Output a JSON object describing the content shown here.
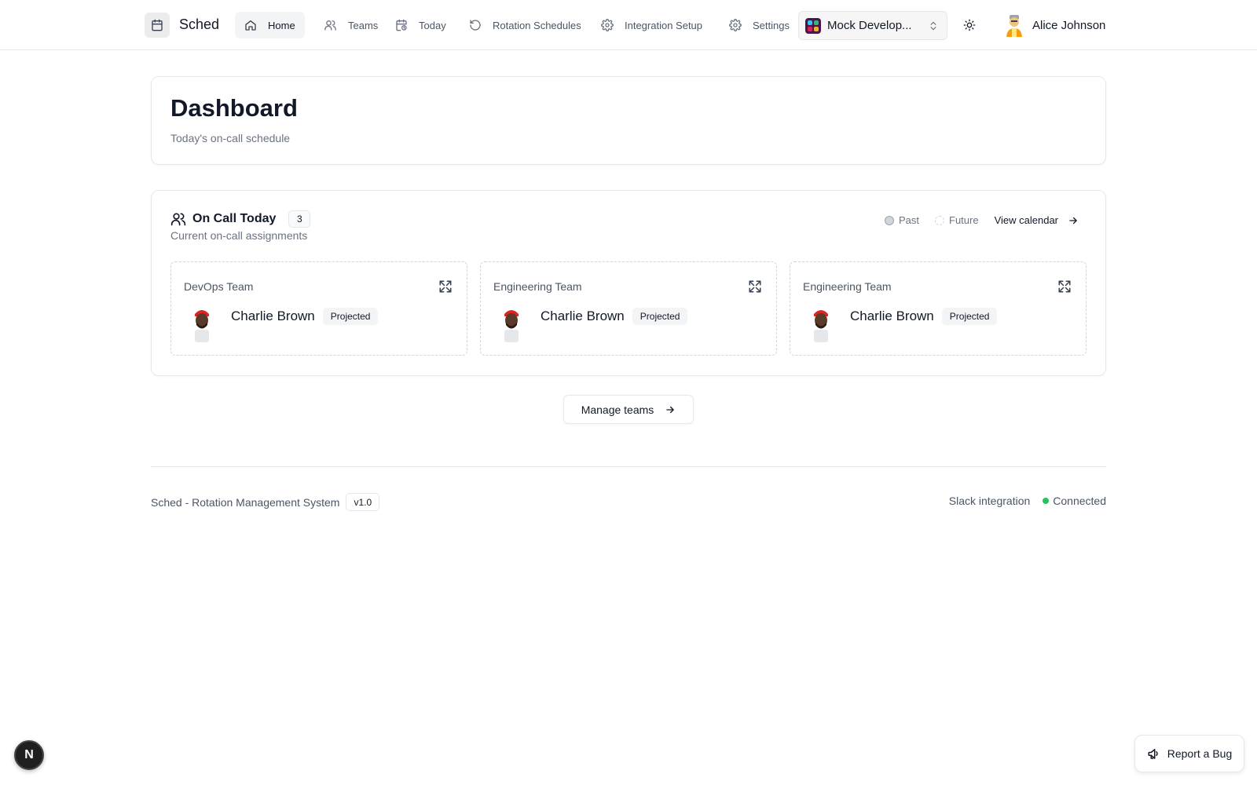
{
  "app": {
    "name": "Sched"
  },
  "nav": {
    "items": [
      {
        "label": "Home",
        "icon": "home-icon",
        "active": true
      },
      {
        "label": "Teams",
        "icon": "users-icon"
      },
      {
        "label": "Today",
        "icon": "calendar-clock-icon"
      },
      {
        "label": "Rotation Schedules",
        "icon": "rotate-icon"
      },
      {
        "label": "Integration Setup",
        "icon": "gear-icon"
      },
      {
        "label": "Settings",
        "icon": "gear-icon"
      }
    ]
  },
  "workspace": {
    "name": "Mock Develop..."
  },
  "user": {
    "name": "Alice Johnson"
  },
  "header": {
    "title": "Dashboard",
    "subtitle": "Today's on-call schedule"
  },
  "oncall": {
    "title": "On Call Today",
    "count": "3",
    "subtitle": "Current on-call assignments",
    "legend": {
      "past": "Past",
      "future": "Future"
    },
    "view_calendar": "View calendar",
    "teams": [
      {
        "team": "DevOps Team",
        "person": "Charlie Brown",
        "status": "Projected"
      },
      {
        "team": "Engineering Team",
        "person": "Charlie Brown",
        "status": "Projected"
      },
      {
        "team": "Engineering Team",
        "person": "Charlie Brown",
        "status": "Projected"
      }
    ]
  },
  "manage": {
    "label": "Manage teams"
  },
  "footer": {
    "app_label": "Sched - Rotation Management System",
    "version": "v1.0",
    "integration_label": "Slack integration",
    "integration_status": "Connected"
  },
  "floating": {
    "next_badge": "N",
    "report_bug": "Report a Bug"
  },
  "colors": {
    "status_connected": "#22c55e",
    "workspace_brand": "#4a154b"
  }
}
